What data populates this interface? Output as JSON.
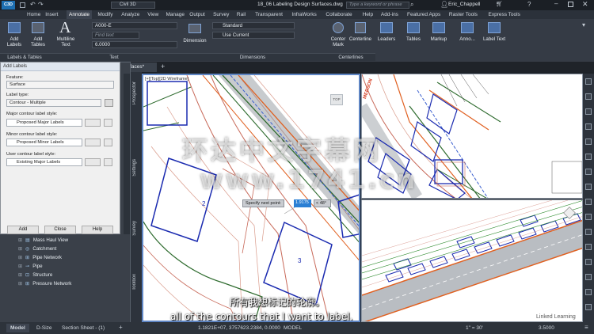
{
  "titlebar": {
    "app_badge": "C3D",
    "product": "Civil 3D",
    "document": "18_06 Labeling Design Surfaces.dwg",
    "search_placeholder": "Type a keyword or phrase",
    "user": "Eric_Chappell"
  },
  "ribbon_tabs": [
    "Home",
    "Insert",
    "Annotate",
    "Modify",
    "Analyze",
    "View",
    "Manage",
    "Output",
    "Survey",
    "Rail",
    "Transparent",
    "InfraWorks",
    "Collaborate",
    "Help",
    "Add-ins",
    "Featured Apps",
    "Raster Tools",
    "Express Tools"
  ],
  "active_tab": "Annotate",
  "ribbon": {
    "add_labels": "Add\nLabels",
    "add_tables": "Add\nTables",
    "multiline_text": "Multiline\nText",
    "text_style": "A000-E",
    "find_text_placeholder": "Find text",
    "text_height": "6.0000",
    "dimension": "Dimension",
    "dim_style": "Standard",
    "dim_layer": "Use Current",
    "center_mark": "Center\nMark",
    "centerline": "Centerline",
    "leaders": "Leaders",
    "tables": "Tables",
    "markup": "Markup",
    "annotation_scale": "Anno...",
    "label_text": "Label Text",
    "panel_labels_tables": "Labels & Tables",
    "panel_text": "Text",
    "panel_dimensions": "Dimensions",
    "panel_centerlines": "Centerlines"
  },
  "file_tab": "Surfaces*",
  "viewport_label": "[+][Top][2D Wireframe]",
  "palette_tabs": [
    "Prospector",
    "Settings",
    "Survey",
    "Toolbox"
  ],
  "dialog": {
    "title": "Add Labels",
    "feature_label": "Feature:",
    "feature_value": "Surface",
    "label_type_label": "Label type:",
    "label_type_value": "Contour - Multiple",
    "major_label": "Major contour label style:",
    "major_value": "Proposed Major Labels",
    "minor_label": "Minor contour label style:",
    "minor_value": "Proposed Minor Labels",
    "user_label": "User contour label style:",
    "user_value": "Existing Major Labels",
    "add_button": "Add",
    "close_button": "Close",
    "help_button": "Help"
  },
  "tree_items": [
    "Mass Haul View",
    "Catchment",
    "Pipe Network",
    "Pipe",
    "Structure",
    "Pressure Network"
  ],
  "view_cube": "TOP",
  "prompt": {
    "text": "Specify next point:",
    "value": "1.9175",
    "angle": "< 48°"
  },
  "lot_numbers": [
    "2",
    "3"
  ],
  "road_label": "MERSON",
  "layout_tabs": [
    "Model",
    "D-Size",
    "Section Sheet - (1)"
  ],
  "status": {
    "coords": "1.1821E+07, 3757623.2384, 0.0000",
    "mode": "MODEL",
    "scale": "1\" = 30'",
    "value": "3.5000"
  },
  "captions": {
    "chinese": "所有我想标记的轮廓。",
    "english": "all of the contours that I want to label."
  },
  "watermark": {
    "line1": "环达中文字幕网",
    "line2": "www.1741.cn"
  },
  "brand": "Linked Learning"
}
